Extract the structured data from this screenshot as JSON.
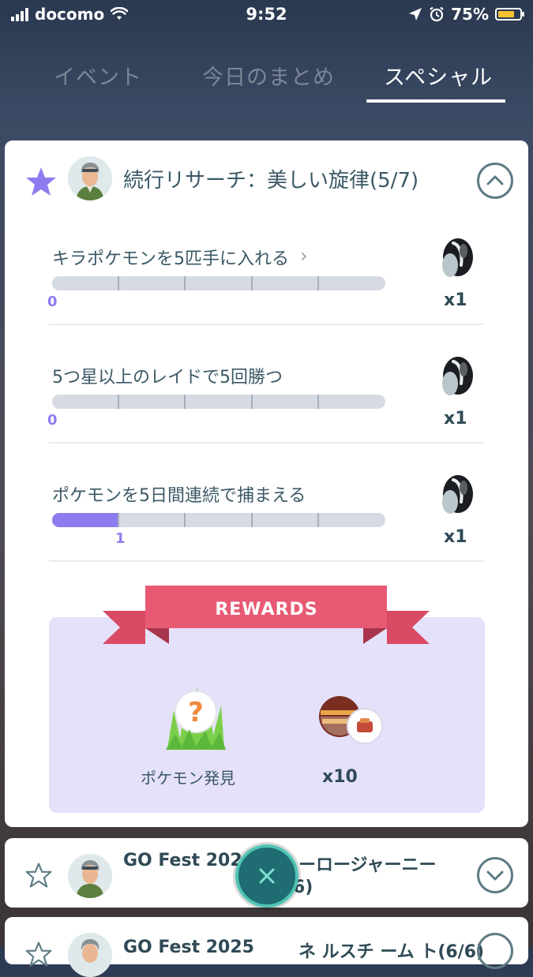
{
  "status_bar": {
    "carrier": "docomo",
    "time": "9:52",
    "battery_percent": "75%",
    "battery_level": 0.75
  },
  "tabs": [
    {
      "label": "イベント",
      "active": false
    },
    {
      "label": "今日のまとめ",
      "active": false
    },
    {
      "label": "スペシャル",
      "active": true
    }
  ],
  "research": {
    "title": "続行リサーチ：美しい旋律(5/7)",
    "tasks": [
      {
        "label": "キラポケモンを5匹手に入れる",
        "has_arrow": true,
        "progress": 0,
        "goal": 5,
        "progress_text": "0",
        "reward_count": "x1",
        "reward_icon": "black-augurite-icon"
      },
      {
        "label": "5つ星以上のレイドで5回勝つ",
        "has_arrow": false,
        "progress": 0,
        "goal": 5,
        "progress_text": "0",
        "reward_count": "x1",
        "reward_icon": "black-augurite-icon"
      },
      {
        "label": "ポケモンを5日間連続で捕まえる",
        "has_arrow": false,
        "progress": 1,
        "goal": 5,
        "progress_text": "1",
        "reward_count": "x1",
        "reward_icon": "black-augurite-icon"
      }
    ],
    "rewards_banner": "REWARDS",
    "rewards": [
      {
        "label": "ポケモン発見",
        "icon": "pokemon-encounter-icon"
      },
      {
        "label": "x10",
        "icon": "ultra-ball-icon"
      }
    ]
  },
  "more_research": [
    {
      "title_left": "GO Fest 202",
      "title_right": "ーロージャーニー",
      "subtitle": "6)"
    },
    {
      "title_left": "GO Fest 2025",
      "title_right": "ネ ルスチ ーム ト(6/6)"
    }
  ],
  "colors": {
    "accent_purple": "#8c7cf0",
    "ribbon_pink": "#e85a74",
    "rewards_bg": "#e5e1fb",
    "fab_teal": "#1f6d72"
  }
}
